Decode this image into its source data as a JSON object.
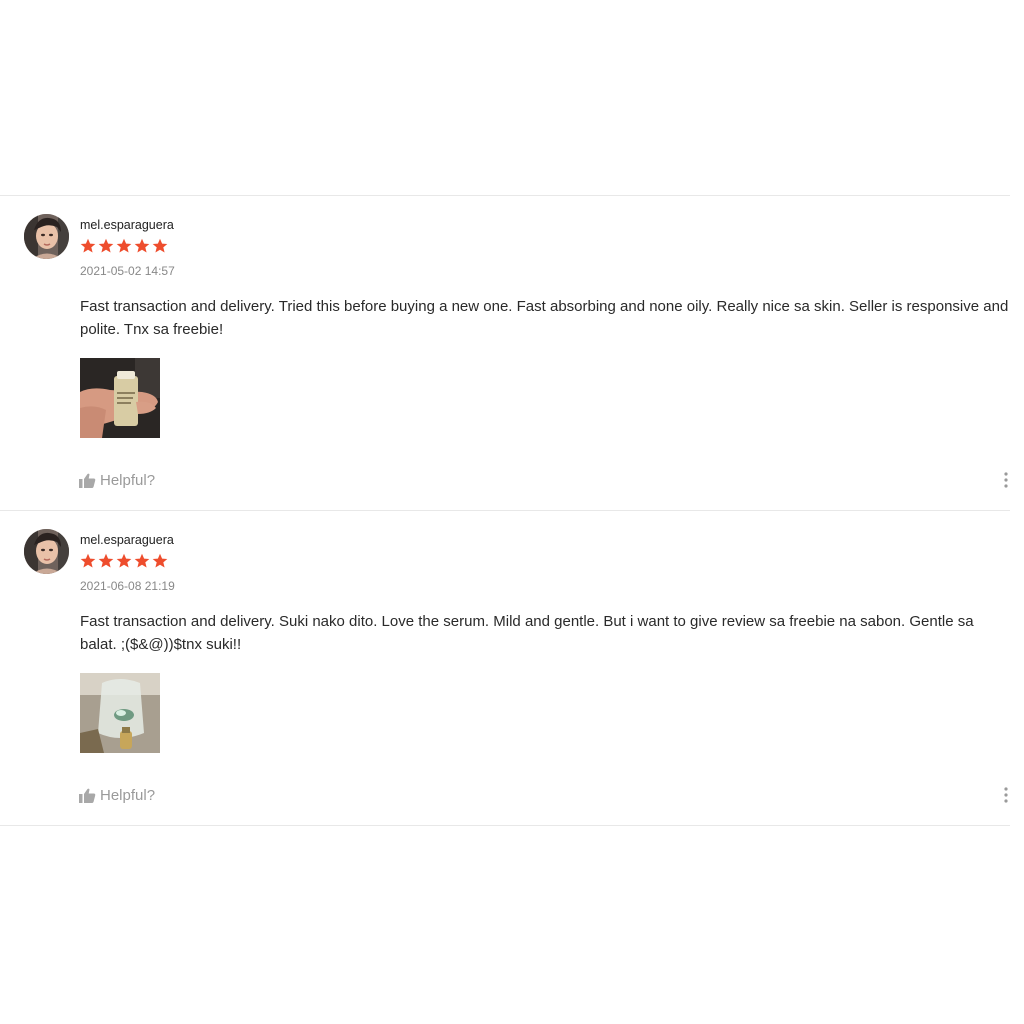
{
  "colors": {
    "star": "#ee4d2d",
    "divider": "#e8e8e8",
    "muted": "#9a9a9a"
  },
  "reviews": [
    {
      "username": "mel.esparaguera",
      "rating": 5,
      "timestamp": "2021-05-02 14:57",
      "comment": "Fast transaction and delivery. Tried this before buying a new one. Fast absorbing and none oily. Really nice sa skin. Seller is responsive and polite. Tnx sa freebie!",
      "helpful_label": "Helpful?",
      "icons": {
        "helpful": "thumbs-up-icon",
        "more": "more-vertical-icon"
      }
    },
    {
      "username": "mel.esparaguera",
      "rating": 5,
      "timestamp": "2021-06-08 21:19",
      "comment": "Fast transaction and delivery. Suki nako dito. Love the serum. Mild and gentle. But i want to give review sa freebie na sabon. Gentle sa balat. ;($&@))$tnx suki!!",
      "helpful_label": "Helpful?",
      "icons": {
        "helpful": "thumbs-up-icon",
        "more": "more-vertical-icon"
      }
    }
  ]
}
